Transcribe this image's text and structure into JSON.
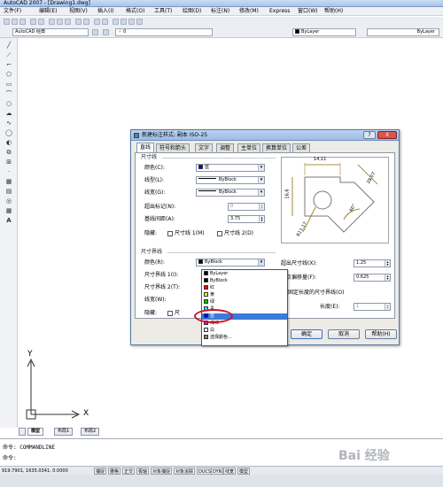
{
  "app": {
    "title": "AutoCAD 2007 - [Drawing1.dwg]",
    "menus": [
      "文件(F)",
      "编辑(E)",
      "视图(V)",
      "插入(I)",
      "格式(O)",
      "工具(T)",
      "绘图(D)",
      "标注(N)",
      "修改(M)",
      "Express",
      "窗口(W)",
      "帮助(H)"
    ]
  },
  "toolbar": {
    "workspace": "AutoCAD 经典",
    "layer": "0",
    "bylayer1": "ByLayer",
    "bylayer2": "ByLayer",
    "bylayer3": "ByLayer"
  },
  "ucs": {
    "x": "X",
    "y": "Y"
  },
  "tabs": {
    "model": "模型",
    "layout1": "布局1",
    "layout2": "布局2"
  },
  "command": {
    "line1": "命令: COMMANDLINE",
    "line2": "命令:"
  },
  "status": {
    "coords": "919.7901, 1635.0341, 0.0000",
    "toggles": [
      "捕捉",
      "栅格",
      "正交",
      "极轴",
      "对象捕捉",
      "对象追踪",
      "DUCS",
      "DYN",
      "线宽",
      "模型"
    ]
  },
  "watermark": "Bai 经验",
  "dialog": {
    "title": "新建标注样式: 副本 ISO-25",
    "help_btn": "?",
    "close_btn": "X",
    "tabs": [
      "直线",
      "符号和箭头",
      "文字",
      "调整",
      "主单位",
      "换算单位",
      "公差"
    ],
    "dim_lines": {
      "group": "尺寸线",
      "color_label": "颜色(C):",
      "color_value": "蓝",
      "linetype_label": "线型(L):",
      "linetype_value": "ByBlock",
      "lineweight_label": "线宽(G):",
      "lineweight_value": "ByBlock",
      "extend_label": "超出标记(N):",
      "extend_value": "0",
      "baseline_label": "基线间距(A):",
      "baseline_value": "3.75",
      "suppress_label": "隐藏:",
      "suppress1": "尺寸线 1(M)",
      "suppress2": "尺寸线 2(D)"
    },
    "ext_lines": {
      "group": "尺寸界线",
      "color_label": "颜色(R):",
      "color_value": "ByBlock",
      "ext1_label": "尺寸界线 1(I):",
      "ext2_label": "尺寸界线 2(T):",
      "lineweight_label": "线宽(W):",
      "suppress_label": "隐藏:",
      "suppress1": "尺",
      "beyond_label": "超出尺寸线(X):",
      "beyond_value": "1.25",
      "offset_label": "起点偏移量(F):",
      "offset_value": "0.625",
      "fixed_label": "固定长度的尺寸界线(O)",
      "length_label": "长度(E):",
      "length_value": "1"
    },
    "color_options": [
      {
        "name": "ByLayer",
        "color": "#000000"
      },
      {
        "name": "ByBlock",
        "color": "#000000"
      },
      {
        "name": "红",
        "color": "#ff0000"
      },
      {
        "name": "黄",
        "color": "#ffff00"
      },
      {
        "name": "绿",
        "color": "#00c000"
      },
      {
        "name": "青",
        "color": "#00ffff"
      },
      {
        "name": "蓝",
        "color": "#0000ff"
      },
      {
        "name": "洋红",
        "color": "#ff00ff"
      },
      {
        "name": "白",
        "color": "#ffffff"
      },
      {
        "name": "选择颜色...",
        "color": "#808080"
      }
    ],
    "selected_color_index": 6,
    "preview": {
      "dim_top": "14,11",
      "dim_left": "16,6",
      "dim_right": "28,07",
      "dim_angle": "60°",
      "dim_radius": "R11,17"
    },
    "buttons": {
      "ok": "确定",
      "cancel": "取消",
      "help": "帮助(H)"
    }
  }
}
